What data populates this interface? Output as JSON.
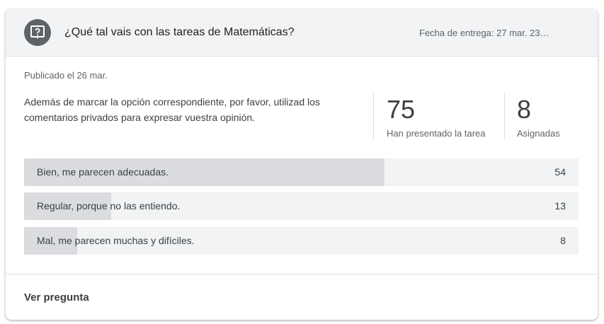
{
  "header": {
    "icon": "question-mark-icon",
    "title": "¿Qué tal vais con las tareas de Matemáticas?",
    "due": "Fecha de entrega: 27 mar. 23…"
  },
  "published": "Publicado el 26 mar.",
  "description": "Además de marcar la opción correspondiente, por favor, utilizad los comentarios privados para expresar vuestra opinión.",
  "stats": {
    "submitted_value": "75",
    "submitted_label": "Han presentado la tarea",
    "assigned_value": "8",
    "assigned_label": "Asignadas"
  },
  "options": [
    {
      "label": "Bien, me parecen adecuadas.",
      "count": "54",
      "fraction": 0.65
    },
    {
      "label": "Regular, porque no las entiendo.",
      "count": "13",
      "fraction": 0.157
    },
    {
      "label": "Mal, me parecen muchas y difíciles.",
      "count": "8",
      "fraction": 0.096
    }
  ],
  "footer": {
    "view_label": "Ver pregunta"
  },
  "colors": {
    "header_bg": "#f1f3f4",
    "bar_fill": "#dadce0",
    "bar_bg": "#f1f3f4",
    "icon_bg": "#5f6368"
  }
}
